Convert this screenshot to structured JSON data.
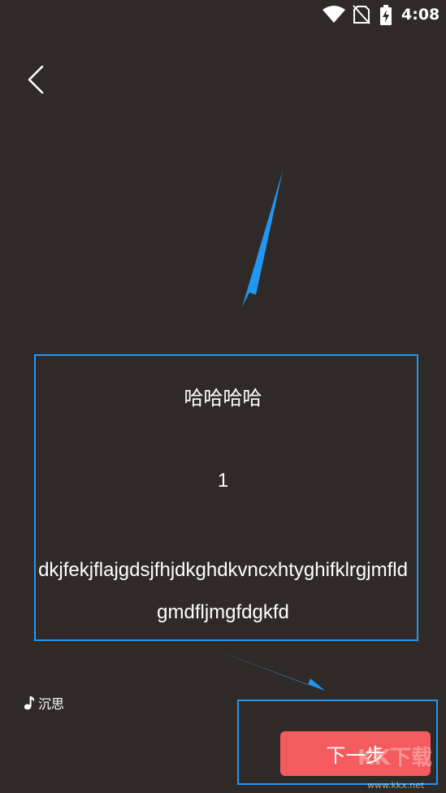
{
  "status_bar": {
    "time": "4:08",
    "icons": [
      "wifi-icon",
      "no-sim-icon",
      "battery-charging-icon"
    ]
  },
  "nav": {
    "back_icon": "chevron-left-icon"
  },
  "lyric_card": {
    "title": "哈哈哈哈",
    "number": "1",
    "text": "dkjfekjflajgdsjfhjdkghdkvncxhtyghifklrgjmfldgmdfljmgfdgkfd"
  },
  "song": {
    "icon": "music-note-icon",
    "name": "沉思"
  },
  "next_button": {
    "label": "下一步"
  },
  "watermark": {
    "text": "KK下载",
    "url": "www.kkx.net"
  },
  "colors": {
    "background": "#2f2a27",
    "annotation_blue": "#2196f3",
    "button_red": "#f45b5f",
    "text": "#ffffff"
  }
}
